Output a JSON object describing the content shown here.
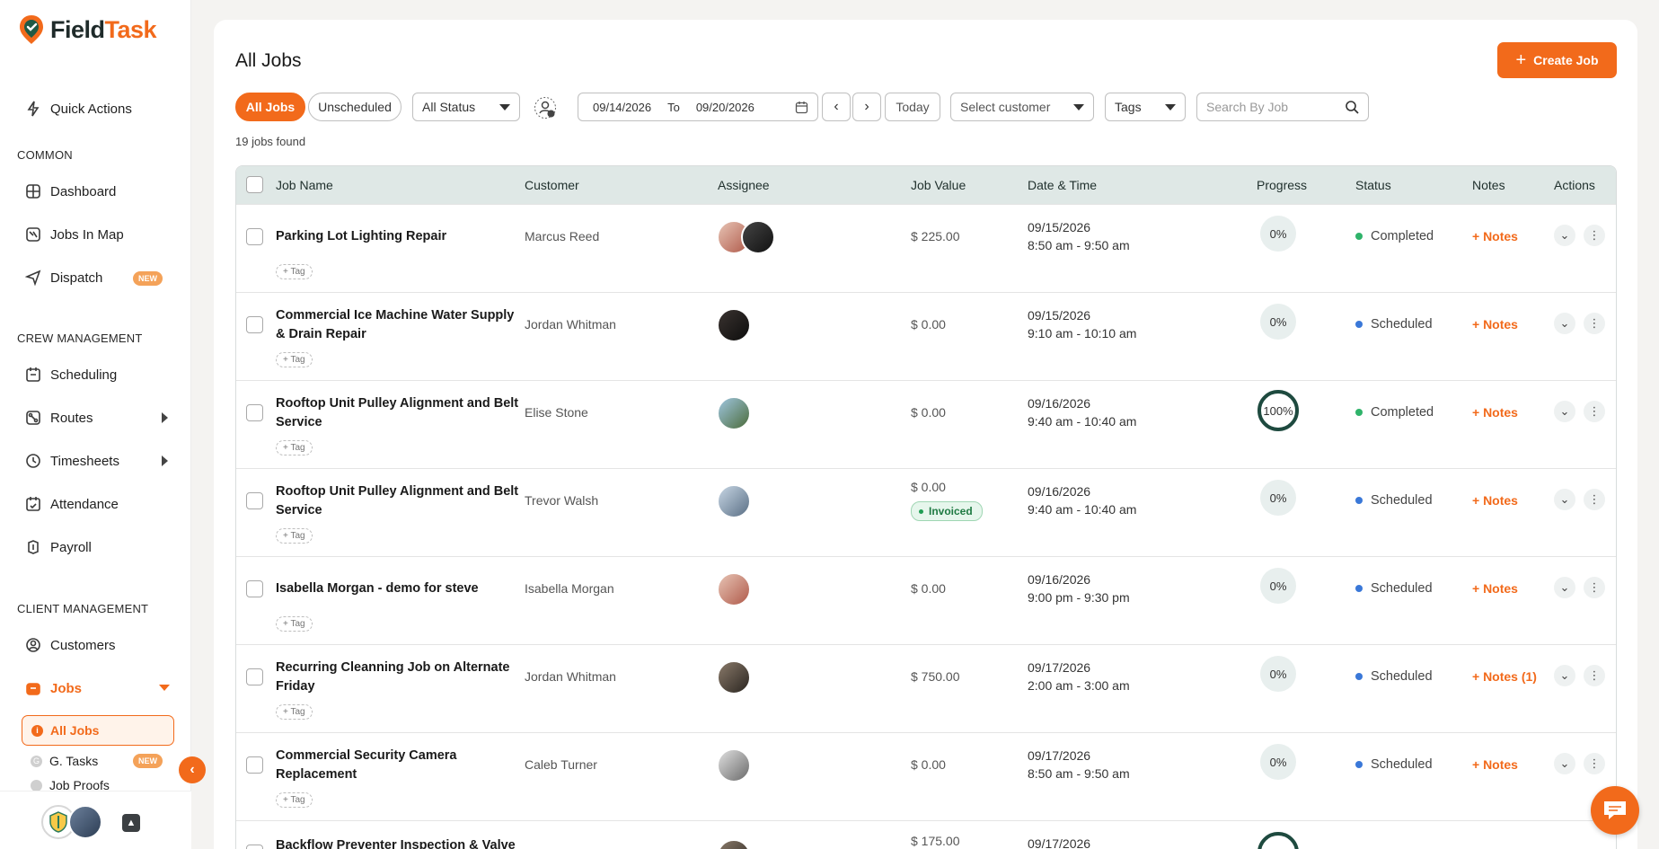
{
  "app": {
    "brand_part1": "Field",
    "brand_part2": "Task"
  },
  "sidebar": {
    "quick_actions": "Quick Actions",
    "common_label": "COMMON",
    "dashboard": "Dashboard",
    "jobs_in_map": "Jobs In Map",
    "dispatch": "Dispatch",
    "new_badge": "NEW",
    "crew_label": "CREW MANAGEMENT",
    "scheduling": "Scheduling",
    "routes": "Routes",
    "timesheets": "Timesheets",
    "attendance": "Attendance",
    "payroll": "Payroll",
    "client_label": "CLIENT MANAGEMENT",
    "customers": "Customers",
    "jobs": "Jobs",
    "sub_all_jobs": "All Jobs",
    "sub_g_tasks": "G. Tasks",
    "sub_job_proofs": "Job Proofs",
    "collapse_icon": "chevron-left-icon"
  },
  "main": {
    "title": "All Jobs",
    "create_job": "Create Job",
    "filters": {
      "all_jobs": "All Jobs",
      "unscheduled": "Unscheduled",
      "all_status": "All Status",
      "date_from": "09/14/2026",
      "date_to_label": "To",
      "date_to": "09/20/2026",
      "today": "Today",
      "customer_placeholder": "Select customer",
      "tags": "Tags",
      "search_placeholder": "Search By Job"
    },
    "jobs_found": "19 jobs found",
    "columns": [
      "Job Name",
      "Customer",
      "Assignee",
      "Job Value",
      "Date & Time",
      "Progress",
      "Status",
      "Notes",
      "Actions"
    ],
    "tag_label": "+ Tag",
    "invoiced_label": "Invoiced",
    "rows": [
      {
        "name": "Parking Lot Lighting Repair",
        "customer": "Marcus Reed",
        "value": "$ 225.00",
        "date": "09/15/2026",
        "time": "8:50 am - 9:50 am",
        "progress": "0%",
        "status": "Completed",
        "notes": "+ Notes"
      },
      {
        "name": "Commercial Ice Machine Water Supply & Drain Repair",
        "customer": "Jordan Whitman",
        "value": "$ 0.00",
        "date": "09/15/2026",
        "time": "9:10 am - 10:10 am",
        "progress": "0%",
        "status": "Scheduled",
        "notes": "+ Notes"
      },
      {
        "name": "Rooftop Unit Pulley Alignment and Belt Service",
        "customer": "Elise Stone",
        "value": "$ 0.00",
        "date": "09/16/2026",
        "time": "9:40 am - 10:40 am",
        "progress": "100%",
        "status": "Completed",
        "notes": "+ Notes"
      },
      {
        "name": "Rooftop Unit Pulley Alignment and Belt Service",
        "customer": "Trevor Walsh",
        "value": "$ 0.00",
        "date": "09/16/2026",
        "time": "9:40 am - 10:40 am",
        "progress": "0%",
        "status": "Scheduled",
        "notes": "+ Notes"
      },
      {
        "name": "Isabella Morgan - demo for steve",
        "customer": "Isabella Morgan",
        "value": "$ 0.00",
        "date": "09/16/2026",
        "time": "9:00 pm - 9:30 pm",
        "progress": "0%",
        "status": "Scheduled",
        "notes": "+ Notes"
      },
      {
        "name": "Recurring Cleanning Job on Alternate Friday",
        "customer": "Jordan Whitman",
        "value": "$ 750.00",
        "date": "09/17/2026",
        "time": "2:00 am - 3:00 am",
        "progress": "0%",
        "status": "Scheduled",
        "notes": "+ Notes (1)"
      },
      {
        "name": "Commercial Security Camera Replacement",
        "customer": "Caleb Turner",
        "value": "$ 0.00",
        "date": "09/17/2026",
        "time": "8:50 am - 9:50 am",
        "progress": "0%",
        "status": "Scheduled",
        "notes": "+ Notes"
      },
      {
        "name": "Backflow Preventer Inspection & Valve",
        "value": "$ 175.00",
        "date": "09/17/2026"
      }
    ]
  },
  "colors": {
    "accent": "#f26a1b",
    "completed": "#2fb36a",
    "scheduled": "#3a78d8",
    "header_bg": "#dfe8e6"
  }
}
